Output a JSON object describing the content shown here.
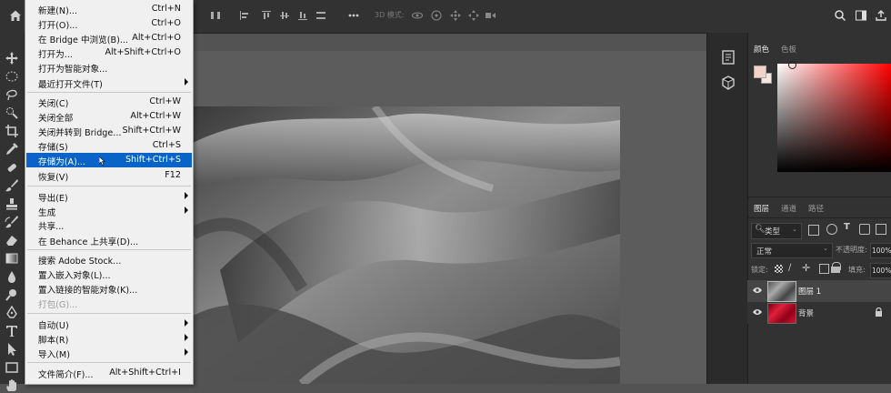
{
  "options_bar": {
    "mode_3d_label": "3D 模式:"
  },
  "file_menu": {
    "items": [
      {
        "label": "新建(N)...",
        "shortcut": "Ctrl+N"
      },
      {
        "label": "打开(O)...",
        "shortcut": "Ctrl+O"
      },
      {
        "label": "在 Bridge 中浏览(B)...",
        "shortcut": "Alt+Ctrl+O"
      },
      {
        "label": "打开为...",
        "shortcut": "Alt+Shift+Ctrl+O"
      },
      {
        "label": "打开为智能对象...",
        "shortcut": ""
      },
      {
        "label": "最近打开文件(T)",
        "shortcut": ""
      },
      {
        "label": "关闭(C)",
        "shortcut": "Ctrl+W"
      },
      {
        "label": "关闭全部",
        "shortcut": "Alt+Ctrl+W"
      },
      {
        "label": "关闭并转到 Bridge...",
        "shortcut": "Shift+Ctrl+W"
      },
      {
        "label": "存储(S)",
        "shortcut": "Ctrl+S"
      },
      {
        "label": "存储为(A)...",
        "shortcut": "Shift+Ctrl+S"
      },
      {
        "label": "恢复(V)",
        "shortcut": "F12"
      },
      {
        "label": "导出(E)",
        "shortcut": ""
      },
      {
        "label": "生成",
        "shortcut": ""
      },
      {
        "label": "共享...",
        "shortcut": ""
      },
      {
        "label": "在 Behance 上共享(D)...",
        "shortcut": ""
      },
      {
        "label": "搜索 Adobe Stock...",
        "shortcut": ""
      },
      {
        "label": "置入嵌入对象(L)...",
        "shortcut": ""
      },
      {
        "label": "置入链接的智能对象(K)...",
        "shortcut": ""
      },
      {
        "label": "打包(G)...",
        "shortcut": ""
      },
      {
        "label": "自动(U)",
        "shortcut": ""
      },
      {
        "label": "脚本(R)",
        "shortcut": ""
      },
      {
        "label": "导入(M)",
        "shortcut": ""
      },
      {
        "label": "文件简介(F)...",
        "shortcut": "Alt+Shift+Ctrl+I"
      }
    ]
  },
  "color_panel": {
    "tabs": [
      "颜色",
      "色板"
    ],
    "foreground": "#f4d2c8",
    "background": "#f7e6e1"
  },
  "layers_panel": {
    "tabs": [
      "图层",
      "通道",
      "路径"
    ],
    "filter_kind": "类型",
    "blend_mode": "正常",
    "opacity_label": "不透明度:",
    "opacity_value": "100%",
    "lock_label": "锁定:",
    "fill_label": "填充:",
    "fill_value": "100%",
    "layers": [
      {
        "name": "图层 1",
        "selected": true
      },
      {
        "name": "背景",
        "selected": false,
        "locked": true
      }
    ]
  }
}
